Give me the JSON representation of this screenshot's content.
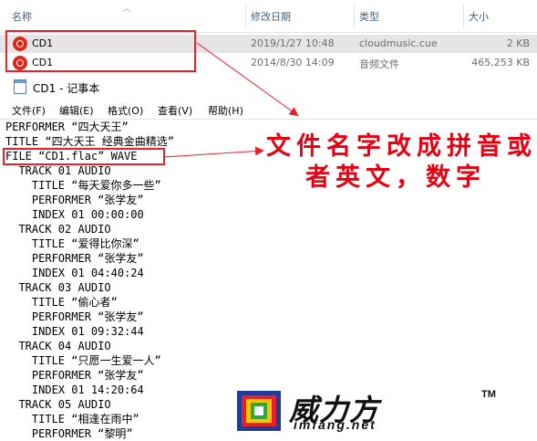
{
  "explorer": {
    "columns": {
      "name": "名称",
      "date": "修改日期",
      "type": "类型",
      "size": "大小"
    },
    "files": [
      {
        "name": "CD1",
        "date": "2019/1/27 10:48",
        "type": "cloudmusic.cue",
        "size": "2 KB",
        "icon": "netease-cloudmusic-icon"
      },
      {
        "name": "CD1",
        "date": "2014/8/30 14:09",
        "type": "音频文件",
        "size": "465,253 KB",
        "icon": "netease-cloudmusic-icon"
      }
    ]
  },
  "notepad": {
    "title": "CD1 - 记事本",
    "menu": [
      "文件(F)",
      "编辑(E)",
      "格式(O)",
      "查看(V)",
      "帮助(H)"
    ],
    "lines": [
      "PERFORMER “四大天王”",
      "TITLE “四大天王 经典金曲精选”",
      "FILE “CD1.flac” WAVE",
      "  TRACK 01 AUDIO",
      "    TITLE “每天爱你多一些”",
      "    PERFORMER “张学友”",
      "    INDEX 01 00:00:00",
      "  TRACK 02 AUDIO",
      "    TITLE “爱得比你深”",
      "    PERFORMER “张学友”",
      "    INDEX 01 04:40:24",
      "  TRACK 03 AUDIO",
      "    TITLE “偷心者”",
      "    PERFORMER “张学友”",
      "    INDEX 01 09:32:44",
      "  TRACK 04 AUDIO",
      "    TITLE “只愿一生爱一人”",
      "    PERFORMER “张学友”",
      "    INDEX 01 14:20:64",
      "  TRACK 05 AUDIO",
      "    TITLE “相逢在雨中”",
      "    PERFORMER “黎明”"
    ]
  },
  "annotation": {
    "line1": "文件名字改成拼音或",
    "line2": "者英文，数字",
    "color": "#e60012"
  },
  "watermark": {
    "brand": "威力方",
    "tm": "TM",
    "url": "imfang.net"
  }
}
